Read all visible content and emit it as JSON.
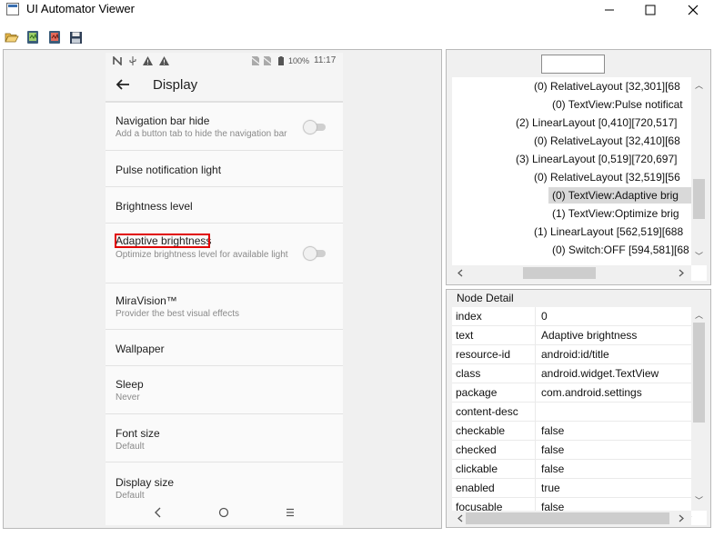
{
  "window": {
    "title": "UI Automator Viewer"
  },
  "toolbar": {
    "buttons": [
      "open-folder-icon",
      "device-screenshot-icon",
      "device-screenshot-compressed-icon",
      "save-icon"
    ]
  },
  "device": {
    "statusbar": {
      "battery": "100%",
      "time": "11:17"
    },
    "appbar_title": "Display",
    "settings": [
      {
        "title": "Navigation bar hide",
        "subtitle": "Add a button tab to hide the navigation bar",
        "has_toggle": true
      },
      {
        "title": "Pulse notification light",
        "subtitle": "",
        "has_toggle": false
      },
      {
        "title": "Brightness level",
        "subtitle": "",
        "has_toggle": false
      },
      {
        "title": "Adaptive brightness",
        "subtitle": "Optimize brightness level for available light",
        "has_toggle": true
      },
      {
        "title": "MiraVision™",
        "subtitle": "Provider the best visual effects",
        "has_toggle": false
      },
      {
        "title": "Wallpaper",
        "subtitle": "",
        "has_toggle": false
      },
      {
        "title": "Sleep",
        "subtitle": "Never",
        "has_toggle": false
      },
      {
        "title": "Font size",
        "subtitle": "Default",
        "has_toggle": false
      },
      {
        "title": "Display size",
        "subtitle": "Default",
        "has_toggle": false
      }
    ]
  },
  "tree": {
    "search_value": "",
    "nodes": [
      {
        "text": "(0) RelativeLayout [32,301][68",
        "indent": 4,
        "selected": false
      },
      {
        "text": "(0) TextView:Pulse notificat",
        "indent": 5,
        "selected": false
      },
      {
        "text": "(2) LinearLayout [0,410][720,517]",
        "indent": 3,
        "selected": false
      },
      {
        "text": "(0) RelativeLayout [32,410][68",
        "indent": 4,
        "selected": false
      },
      {
        "text": "(3) LinearLayout [0,519][720,697]",
        "indent": 3,
        "selected": false
      },
      {
        "text": "(0) RelativeLayout [32,519][56",
        "indent": 4,
        "selected": false
      },
      {
        "text": "(0) TextView:Adaptive brig",
        "indent": 5,
        "selected": true
      },
      {
        "text": "(1) TextView:Optimize brig",
        "indent": 5,
        "selected": false
      },
      {
        "text": "(1) LinearLayout [562,519][688",
        "indent": 4,
        "selected": false
      },
      {
        "text": "(0) Switch:OFF [594,581][68",
        "indent": 5,
        "selected": false
      }
    ]
  },
  "node_detail": {
    "label": "Node Detail",
    "rows": [
      {
        "key": "index",
        "value": "0"
      },
      {
        "key": "text",
        "value": "Adaptive brightness"
      },
      {
        "key": "resource-id",
        "value": "android:id/title"
      },
      {
        "key": "class",
        "value": "android.widget.TextView"
      },
      {
        "key": "package",
        "value": "com.android.settings"
      },
      {
        "key": "content-desc",
        "value": ""
      },
      {
        "key": "checkable",
        "value": "false"
      },
      {
        "key": "checked",
        "value": "false"
      },
      {
        "key": "clickable",
        "value": "false"
      },
      {
        "key": "enabled",
        "value": "true"
      },
      {
        "key": "focusable",
        "value": "false"
      }
    ]
  }
}
